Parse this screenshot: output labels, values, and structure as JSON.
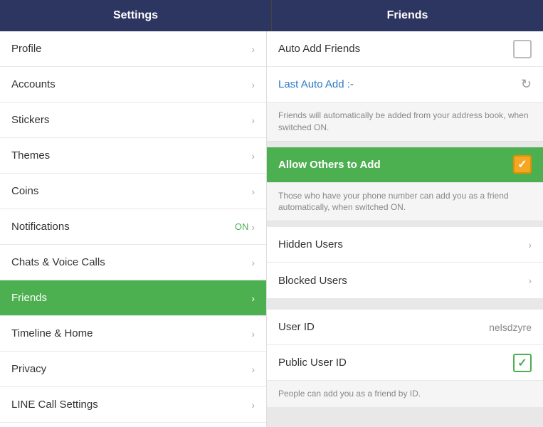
{
  "header": {
    "left_title": "Settings",
    "right_title": "Friends"
  },
  "sidebar": {
    "items": [
      {
        "id": "profile",
        "label": "Profile",
        "badge": "",
        "active": false
      },
      {
        "id": "accounts",
        "label": "Accounts",
        "badge": "",
        "active": false
      },
      {
        "id": "stickers",
        "label": "Stickers",
        "badge": "",
        "active": false
      },
      {
        "id": "themes",
        "label": "Themes",
        "badge": "",
        "active": false
      },
      {
        "id": "coins",
        "label": "Coins",
        "badge": "",
        "active": false
      },
      {
        "id": "notifications",
        "label": "Notifications",
        "badge": "ON",
        "active": false
      },
      {
        "id": "chats-voice",
        "label": "Chats & Voice Calls",
        "badge": "",
        "active": false
      },
      {
        "id": "friends",
        "label": "Friends",
        "badge": "",
        "active": true
      },
      {
        "id": "timeline-home",
        "label": "Timeline & Home",
        "badge": "",
        "active": false
      },
      {
        "id": "privacy",
        "label": "Privacy",
        "badge": "",
        "active": false
      },
      {
        "id": "line-call-settings",
        "label": "LINE Call Settings",
        "badge": "",
        "active": false
      }
    ]
  },
  "friends_panel": {
    "auto_add_label": "Auto Add Friends",
    "last_auto_add_label": "Last Auto Add :-",
    "auto_add_info": "Friends will automatically be added from your address book, when switched ON.",
    "allow_others_label": "Allow Others to Add",
    "allow_others_info": "Those who have your phone number can add you as a friend automatically, when switched ON.",
    "hidden_users_label": "Hidden Users",
    "blocked_users_label": "Blocked Users",
    "user_id_label": "User ID",
    "user_id_value": "nelsdzyre",
    "public_user_id_label": "Public User ID",
    "public_user_id_info": "People can add you as a friend by ID."
  },
  "icons": {
    "chevron": "›",
    "refresh": "↻",
    "checkmark": "✓"
  }
}
